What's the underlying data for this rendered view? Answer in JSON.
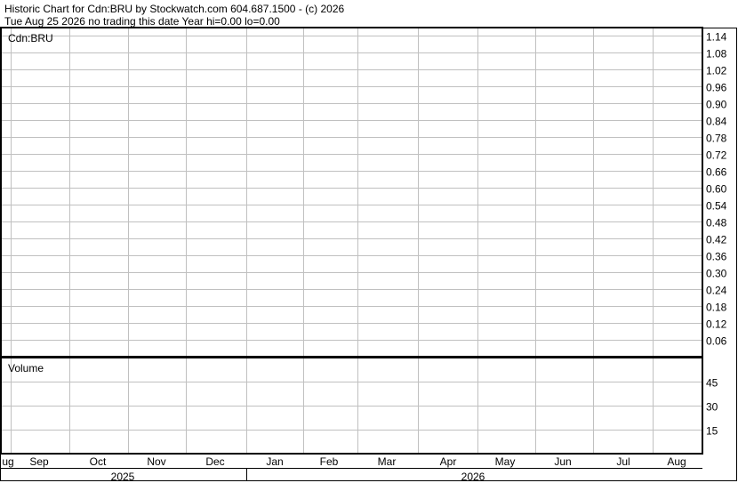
{
  "header": {
    "line1": "Historic Chart for Cdn:BRU by Stockwatch.com 604.687.1500 - (c) 2026",
    "line2": "Tue Aug 25 2026   no trading this date  Year hi=0.00  lo=0.00"
  },
  "chart_data": [
    {
      "type": "line",
      "title": "Cdn:BRU",
      "ylim": [
        0.0,
        1.17
      ],
      "y_ticks": [
        "1.14",
        "1.08",
        "1.02",
        "0.96",
        "0.90",
        "0.84",
        "0.78",
        "0.72",
        "0.66",
        "0.60",
        "0.54",
        "0.48",
        "0.42",
        "0.36",
        "0.30",
        "0.24",
        "0.18",
        "0.12",
        "0.06"
      ],
      "series": [],
      "grid": true,
      "y_axis_position": "right"
    },
    {
      "type": "bar",
      "title": "Volume",
      "ylim": [
        0,
        60
      ],
      "y_ticks": [
        "45",
        "30",
        "15"
      ],
      "series": [],
      "grid": true,
      "y_axis_position": "right"
    }
  ],
  "x_axis": {
    "months": [
      "ug",
      "Sep",
      "Oct",
      "Nov",
      "Dec",
      "Jan",
      "Feb",
      "Mar",
      "Apr",
      "May",
      "Jun",
      "Jul",
      "Aug"
    ],
    "years": [
      "2025",
      "2026"
    ]
  },
  "colors": {
    "grid": "#c0c0c0",
    "border": "#000000",
    "background": "#ffffff"
  }
}
